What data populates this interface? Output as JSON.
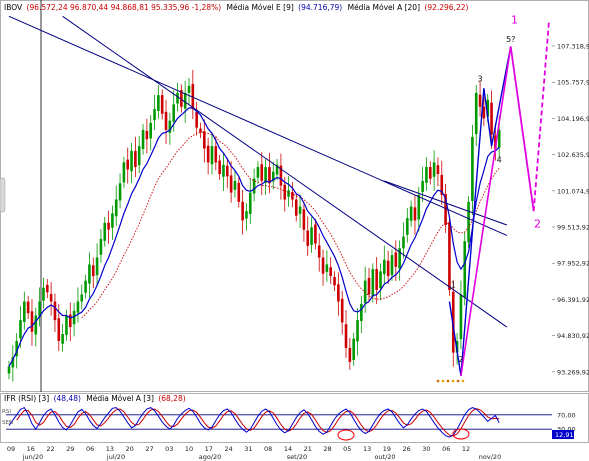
{
  "price_panel": {
    "symbol": "IBOV",
    "ohlc": "(96.572,24  96.870,44  94.868,81  95.335,96  -1,28%)",
    "ema_label": "Média Móvel E [9]",
    "ema_value": "(94.716,79)",
    "sma_label": "Média Móvel A [20]",
    "sma_value": "(92.296,22)"
  },
  "rsi_panel": {
    "title": "IFR (RSI) [3]",
    "value": "(48,48)",
    "ma_label": "Média Móvel A [3]",
    "ma_value": "(68,28)",
    "left_labels": [
      "RSI",
      "SEN"
    ],
    "last_value": "12,91"
  },
  "colors": {
    "up": "#009900",
    "down": "#cc0000",
    "ema": "#0000cc",
    "sma": "#cc0000",
    "trendline": "#000080",
    "projection": "#e000e0",
    "rsi": "#0000cc",
    "rsi_ma": "#cc0000",
    "hdr_blue": "#0000aa",
    "hdr_red": "#cc0000"
  },
  "chart_data": [
    {
      "type": "candlestick",
      "title": "IBOV",
      "y_ticks": [
        "107.318,92",
        "105.757,92",
        "104.196,92",
        "102.635,92",
        "101.074,92",
        "99.513,92",
        "97.952,92",
        "96.391,92",
        "94.830,92",
        "93.269,92"
      ],
      "y_tick_values": [
        107318.92,
        105757.92,
        104196.92,
        102635.92,
        101074.92,
        99513.92,
        97952.92,
        96391.92,
        94830.92,
        93269.92
      ],
      "ylim": [
        92400,
        108700
      ],
      "x_ticks": [
        "09",
        "16",
        "22",
        "29",
        "06",
        "13",
        "20",
        "27",
        "03",
        "10",
        "17",
        "24",
        "31",
        "08",
        "14",
        "21",
        "28",
        "05",
        "13",
        "19",
        "26",
        "30",
        "06",
        "12"
      ],
      "month_labels": [
        "jun/20",
        "jul/20",
        "ago/20",
        "set/20",
        "out/20",
        "nov/20"
      ],
      "closes": [
        93500,
        93900,
        94600,
        95500,
        96300,
        95800,
        95000,
        95700,
        96300,
        96900,
        96700,
        96300,
        95500,
        94600,
        94900,
        95700,
        95200,
        95900,
        96300,
        96600,
        97200,
        97900,
        97400,
        98200,
        99000,
        99700,
        99400,
        100100,
        100700,
        101400,
        102300,
        102000,
        102800,
        102100,
        103000,
        103700,
        103300,
        104000,
        104600,
        105200,
        104400,
        103700,
        104100,
        104800,
        105300,
        104700,
        105300,
        105600,
        104600,
        103800,
        103600,
        102900,
        102300,
        103000,
        102300,
        101800,
        102200,
        101700,
        101000,
        101500,
        100600,
        99800,
        100200,
        101000,
        101600,
        102100,
        101500,
        102100,
        101400,
        101900,
        102200,
        101300,
        100700,
        101100,
        100700,
        100000,
        100400,
        99400,
        98700,
        99500,
        98800,
        98200,
        97500,
        97900,
        97400,
        97000,
        96300,
        95400,
        94300,
        93700,
        94700,
        95500,
        96200,
        97200,
        96600,
        97700,
        96800,
        97600,
        98100,
        97400,
        98300,
        97800,
        98600,
        99100,
        99900,
        100400,
        99800,
        100900,
        101500,
        102100,
        101600,
        102300,
        101800,
        100900,
        99600,
        96800,
        94100,
        94600,
        96600,
        98900,
        100600,
        103400,
        105300,
        104700,
        104200,
        105000,
        103500,
        102900,
        103700
      ],
      "ema_9": [
        93500,
        93800,
        94150,
        94550,
        94900,
        95150,
        95250,
        95450,
        95650,
        95900,
        96050,
        96150,
        96050,
        95850,
        95700,
        95700,
        95600,
        95650,
        95750,
        95850,
        96050,
        96400,
        96650,
        97000,
        97400,
        97850,
        98200,
        98650,
        99100,
        99600,
        100100,
        100500,
        100950,
        101250,
        101600,
        102000,
        102250,
        102600,
        102950,
        103350,
        103550,
        103600,
        103700,
        103950,
        104200,
        104350,
        104500,
        104650,
        104650,
        104500,
        104350,
        104050,
        103750,
        103550,
        103250,
        102900,
        102700,
        102450,
        102150,
        101950,
        101700,
        101300,
        101100,
        101050,
        101150,
        101300,
        101350,
        101500,
        101450,
        101550,
        101650,
        101600,
        101450,
        101350,
        101200,
        100950,
        100850,
        100550,
        100200,
        100000,
        99800,
        99500,
        99150,
        98850,
        98550,
        98250,
        97850,
        97350,
        96750,
        96200,
        95900,
        95850,
        95950,
        96200,
        96300,
        96550,
        96600,
        96800,
        97050,
        97150,
        97350,
        97450,
        97650,
        97950,
        98350,
        98750,
        99050,
        99450,
        99850,
        100300,
        100600,
        100900,
        101100,
        101050,
        100750,
        99950,
        98800,
        98000,
        97700,
        97950,
        98450,
        99450,
        100600,
        101400,
        101950,
        102550,
        102750,
        102800,
        102950
      ],
      "sma_20": [
        null,
        null,
        null,
        null,
        null,
        null,
        null,
        null,
        null,
        null,
        null,
        null,
        null,
        null,
        null,
        null,
        null,
        null,
        null,
        95600,
        95750,
        95950,
        96100,
        96300,
        96550,
        96800,
        97050,
        97300,
        97600,
        97950,
        98300,
        98600,
        98950,
        99300,
        99650,
        100050,
        100450,
        100850,
        101250,
        101600,
        101850,
        102050,
        102300,
        102550,
        102800,
        102950,
        103150,
        103350,
        103450,
        103550,
        103600,
        103600,
        103550,
        103500,
        103400,
        103200,
        103100,
        102950,
        102750,
        102550,
        102300,
        102050,
        101800,
        101600,
        101500,
        101450,
        101300,
        101300,
        101250,
        101250,
        101200,
        101150,
        101050,
        101000,
        100950,
        100850,
        100800,
        100700,
        100550,
        100400,
        100200,
        99950,
        99700,
        99450,
        99200,
        98900,
        98600,
        98250,
        97900,
        97550,
        97300,
        97050,
        96850,
        96700,
        96550,
        96450,
        96400,
        96400,
        96450,
        96500,
        96600,
        96700,
        96800,
        96950,
        97150,
        97350,
        97550,
        97800,
        98100,
        98400,
        98700,
        99000,
        99300,
        99550,
        99700,
        99650,
        99450,
        99300,
        99250,
        99300,
        99500,
        99800,
        100200,
        100600,
        100950,
        101300,
        101600,
        101850,
        102050
      ],
      "trendlines": [
        {
          "from": [
            "day_0",
            108600
          ],
          "to": [
            "day_130",
            99150
          ]
        },
        {
          "from": [
            "day_14",
            108600
          ],
          "to": [
            "day_130",
            95200
          ]
        },
        {
          "from": [
            "day_98",
            101500
          ],
          "to": [
            "day_130",
            99600
          ]
        }
      ],
      "wave_labels": [
        {
          "text": "1",
          "day": 116,
          "price": 96900
        },
        {
          "text": "2",
          "day": 118,
          "price": 93700
        },
        {
          "text": "3",
          "day": 123,
          "price": 105800
        },
        {
          "text": "4",
          "day": 128,
          "price": 102300
        },
        {
          "text": "5?",
          "day": 131,
          "price": 107500
        }
      ],
      "projection_labels": [
        {
          "text": "1",
          "day": 132,
          "price": 108300
        },
        {
          "text": "2",
          "day": 138,
          "price": 99500
        }
      ]
    },
    {
      "type": "line",
      "title": "IFR (RSI) [3]",
      "y_ticks": [
        "70,00",
        "30,00"
      ],
      "y_tick_values": [
        70,
        30
      ],
      "ylim": [
        0,
        100
      ],
      "series": [
        {
          "name": "IFR (RSI) [3]",
          "values": [
            40,
            55,
            70,
            85,
            90,
            72,
            45,
            30,
            48,
            68,
            80,
            86,
            70,
            50,
            35,
            28,
            42,
            60,
            78,
            85,
            74,
            55,
            40,
            32,
            46,
            62,
            75,
            88,
            90,
            80,
            64,
            48,
            34,
            40,
            58,
            74,
            86,
            90,
            82,
            66,
            50,
            38,
            30,
            42,
            60,
            72,
            82,
            88,
            80,
            64,
            46,
            34,
            28,
            36,
            54,
            70,
            82,
            86,
            76,
            58,
            42,
            30,
            22,
            30,
            48,
            66,
            80,
            86,
            78,
            60,
            42,
            28,
            20,
            26,
            44,
            62,
            76,
            84,
            74,
            56,
            38,
            24,
            16,
            22,
            40,
            58,
            72,
            80,
            86,
            76,
            58,
            40,
            26,
            18,
            24,
            42,
            60,
            74,
            82,
            86,
            78,
            62,
            46,
            34,
            42,
            58,
            72,
            82,
            86,
            80,
            64,
            48,
            34,
            22,
            12,
            8,
            14,
            30,
            50,
            70,
            84,
            90,
            86,
            76,
            64,
            52,
            60,
            68,
            48
          ]
        },
        {
          "name": "Média Móvel A [3]",
          "values": [
            null,
            null,
            55,
            70,
            82,
            82,
            69,
            49,
            41,
            49,
            65,
            78,
            79,
            69,
            52,
            38,
            35,
            43,
            60,
            74,
            79,
            71,
            56,
            42,
            39,
            48,
            61,
            75,
            84,
            86,
            78,
            64,
            49,
            41,
            44,
            57,
            73,
            83,
            86,
            79,
            66,
            51,
            39,
            37,
            44,
            58,
            71,
            81,
            83,
            77,
            63,
            48,
            36,
            33,
            39,
            53,
            69,
            79,
            81,
            73,
            59,
            43,
            31,
            27,
            33,
            48,
            65,
            77,
            81,
            75,
            60,
            43,
            30,
            25,
            30,
            44,
            61,
            74,
            78,
            71,
            56,
            39,
            26,
            21,
            26,
            40,
            57,
            70,
            79,
            81,
            73,
            58,
            41,
            28,
            23,
            28,
            42,
            59,
            72,
            81,
            82,
            75,
            62,
            47,
            41,
            45,
            57,
            71,
            80,
            83,
            77,
            64,
            49,
            35,
            23,
            14,
            11,
            17,
            31,
            50,
            68,
            81,
            87,
            84,
            75,
            64,
            59,
            60,
            59
          ]
        }
      ]
    }
  ]
}
